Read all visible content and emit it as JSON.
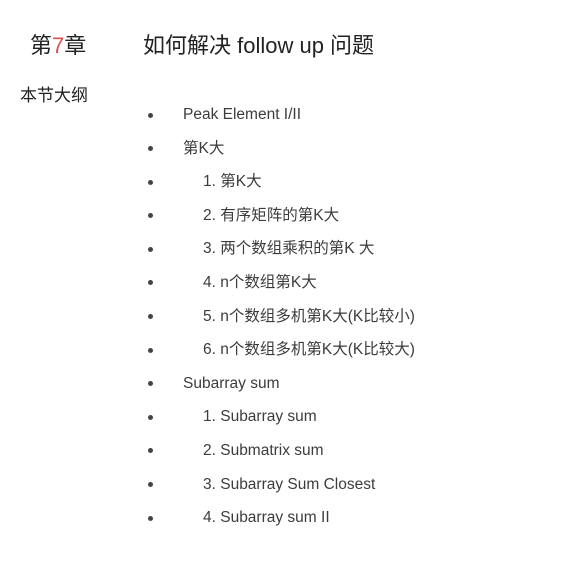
{
  "header": {
    "chapter_prefix": "第",
    "chapter_number": "7",
    "chapter_suffix": "章",
    "chapter_title": "如何解决 follow up 问题",
    "section_label": "本节大纲"
  },
  "colors": {
    "accent": "#d9534f",
    "text": "#333333",
    "background": "#ffffff"
  },
  "outline": [
    {
      "level": 1,
      "text": "Peak Element I/II"
    },
    {
      "level": 1,
      "text": "第K大"
    },
    {
      "level": 2,
      "text": "1. 第K大"
    },
    {
      "level": 2,
      "text": "2. 有序矩阵的第K大"
    },
    {
      "level": 2,
      "text": "3. 两个数组乘积的第K 大"
    },
    {
      "level": 2,
      "text": "4. n个数组第K大"
    },
    {
      "level": 2,
      "text": "5. n个数组多机第K大(K比较小)"
    },
    {
      "level": 2,
      "text": "6. n个数组多机第K大(K比较大)"
    },
    {
      "level": 1,
      "text": "Subarray sum"
    },
    {
      "level": 2,
      "text": "1. Subarray sum"
    },
    {
      "level": 2,
      "text": "2. Submatrix sum"
    },
    {
      "level": 2,
      "text": "3. Subarray Sum Closest"
    },
    {
      "level": 2,
      "text": "4. Subarray sum II"
    }
  ]
}
